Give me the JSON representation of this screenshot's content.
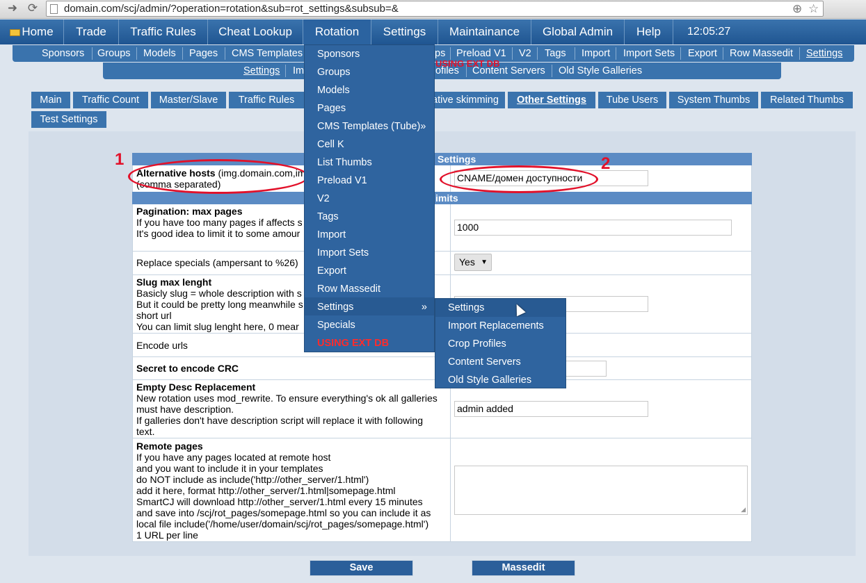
{
  "browser": {
    "url": "domain.com/scj/admin/?operation=rotation&sub=rot_settings&subsub=&"
  },
  "top_menu": {
    "items": [
      "Home",
      "Trade",
      "Traffic Rules",
      "Cheat Lookup",
      "Rotation",
      "Settings",
      "Maintainance",
      "Global Admin",
      "Help"
    ],
    "clock": "12:05:27"
  },
  "sub_menu_1": [
    "Sponsors",
    "Groups",
    "Models",
    "Pages",
    "CMS Templates",
    "ps",
    "Preload V1",
    "V2",
    "Tags",
    "Import",
    "Import Sets",
    "Export",
    "Row Massedit",
    "Settings"
  ],
  "sub_menu_2": [
    "Settings",
    "Im",
    "ofiles",
    "Content Servers",
    "Old Style Galleries"
  ],
  "ext_db": "USING EXT DB",
  "tabs": [
    "Main",
    "Traffic Count",
    "Master/Slave",
    "Traffic Rules",
    "ative skimming",
    "Other Settings",
    "Tube Users",
    "System Thumbs",
    "Related Thumbs",
    "Test Settings"
  ],
  "sections": {
    "settings_header": "Settings",
    "limits_header": "imits"
  },
  "rows": {
    "alt_hosts_title": "Alternative hosts",
    "alt_hosts_hint": " (img.domain.com,im",
    "alt_hosts_note": "(comma separated)",
    "alt_hosts_value": "CNAME/домен доступности",
    "pagination_title": "Pagination: max pages",
    "pagination_line1": "If you have too many pages if affects s",
    "pagination_line2": "It's good idea to limit it to some amour",
    "pagination_value": "1000",
    "replace_specials": "Replace specials (ampersant to %26)",
    "replace_specials_value": "Yes",
    "slug_title": "Slug max lenght",
    "slug_line1": "Basicly slug = whole description with s",
    "slug_line2": "But it could be pretty long meanwhile s",
    "slug_line3": "short url",
    "slug_line4": "You can limit slug lenght here, 0 mear",
    "encode_urls": "Encode urls",
    "secret_title": "Secret to encode CRC",
    "empty_desc_title": "Empty Desc Replacement",
    "empty_desc_line1": "New rotation uses mod_rewrite. To ensure everything's ok all galleries",
    "empty_desc_line2": "must have description.",
    "empty_desc_line3": "If galleries don't have description script will replace it with following",
    "empty_desc_line4": "text.",
    "empty_desc_value": "admin added",
    "remote_title": "Remote pages",
    "remote_line1": "If you have any pages located at remote host",
    "remote_line2": "and you want to include it in your templates",
    "remote_line3": "do NOT include as include('http://other_server/1.html')",
    "remote_line4": "add it here, format http://other_server/1.html|somepage.html",
    "remote_line5": "SmartCJ will download http://other_server/1.html every 15 minutes",
    "remote_line6": "and save into /scj/rot_pages/somepage.html so you can include it as",
    "remote_line7": "local file include('/home/user/domain/scj/rot_pages/somepage.html')",
    "remote_line8": "1 URL per line"
  },
  "annotations": [
    "1",
    "2"
  ],
  "dropdown": {
    "items": [
      "Sponsors",
      "Groups",
      "Models",
      "Pages",
      "CMS Templates (Tube)»",
      "Cell K",
      "List Thumbs",
      "Preload V1",
      "V2",
      "Tags",
      "Import",
      "Import Sets",
      "Export",
      "Row Massedit",
      "Settings",
      "Specials",
      "USING EXT DB"
    ],
    "settings_arrow": "»"
  },
  "flyout": [
    "Settings",
    "Import Replacements",
    "Crop Profiles",
    "Content Servers",
    "Old Style Galleries"
  ],
  "buttons": {
    "save": "Save",
    "massedit": "Massedit"
  },
  "colors": {
    "menu_blue": "#1f5591",
    "annotation_red": "#e2112a"
  }
}
